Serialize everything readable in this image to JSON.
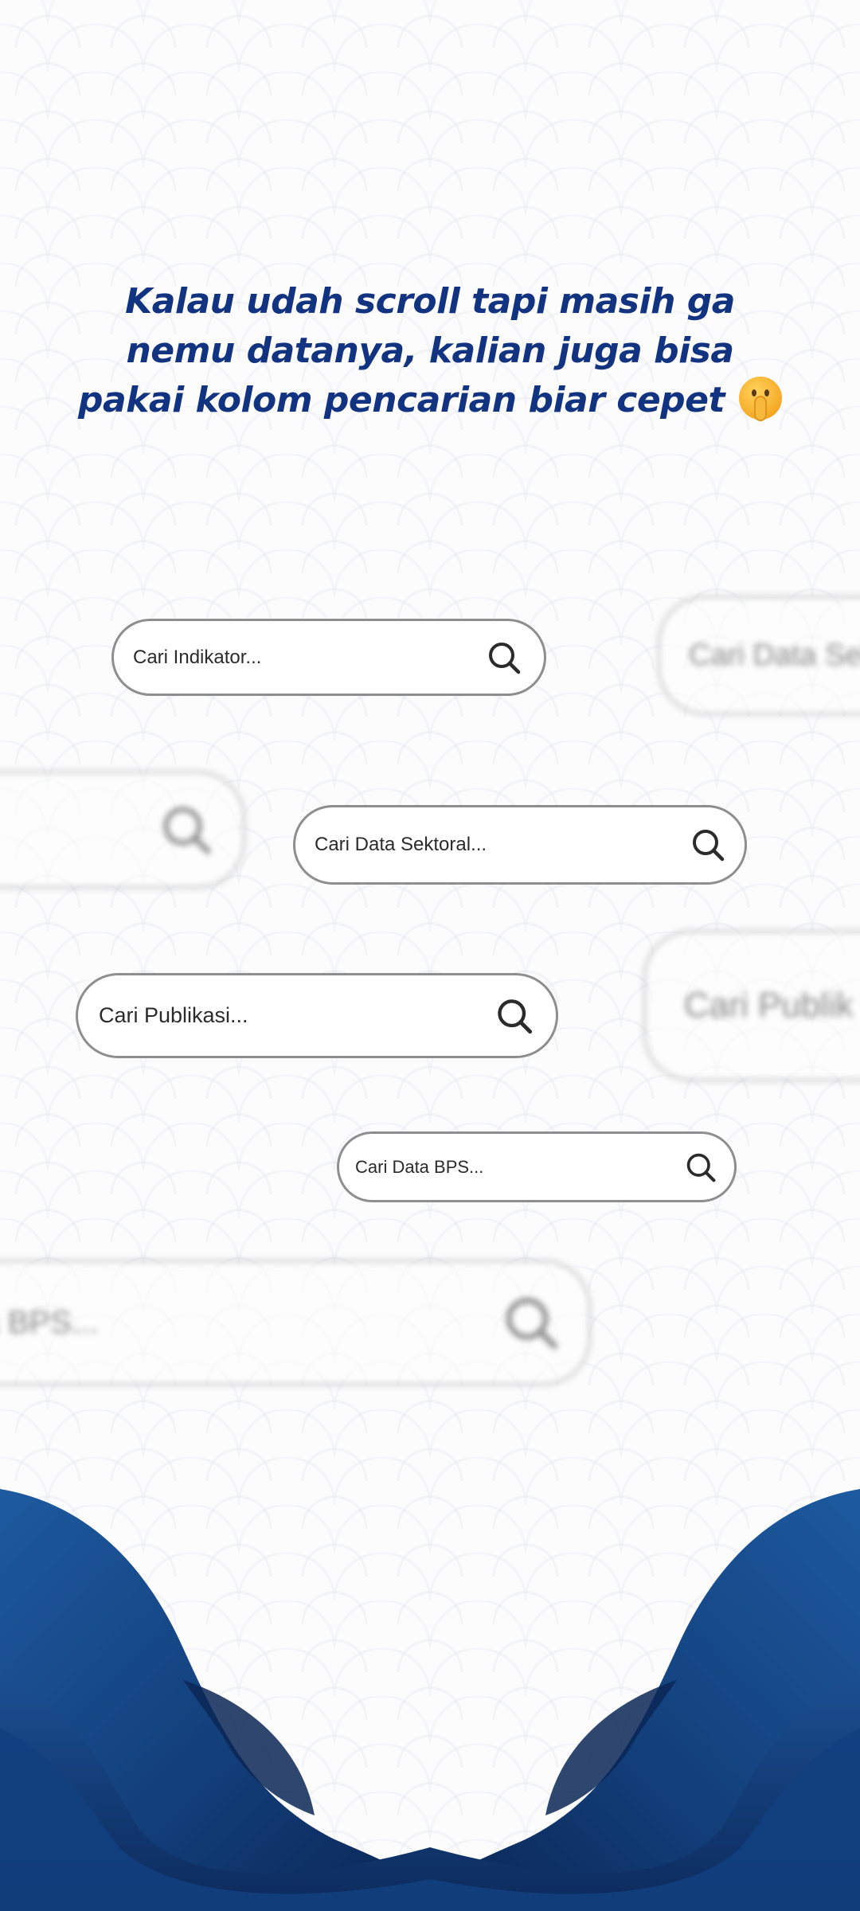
{
  "headline": {
    "text": "Kalau udah scroll tapi masih ga nemu datanya, kalian juga bisa pakai kolom pencarian biar cepet"
  },
  "emoji": "shushing-face-icon",
  "search_bars": [
    {
      "placeholder": "Cari Indikator...",
      "blurred": false
    },
    {
      "placeholder": "Cari Data Sek",
      "blurred": true
    },
    {
      "placeholder": "",
      "blurred": true
    },
    {
      "placeholder": "Cari Data Sektoral...",
      "blurred": false
    },
    {
      "placeholder": "Cari Publikasi...",
      "blurred": false
    },
    {
      "placeholder": "Cari Publik",
      "blurred": true
    },
    {
      "placeholder": "Cari Data BPS...",
      "blurred": false
    },
    {
      "placeholder": "ata BPS...",
      "blurred": true
    }
  ],
  "icons": {
    "search": "search-icon"
  },
  "colors": {
    "headline": "#12337f",
    "wave_dark": "#0d2b5e",
    "wave_mid": "#1a4a8a",
    "search_border": "#8e8e8e",
    "search_text": "#2b2b2b"
  }
}
